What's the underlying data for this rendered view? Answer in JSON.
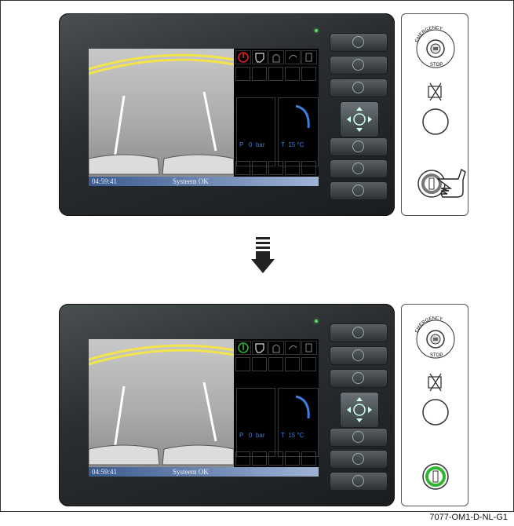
{
  "figure_id": "7077-OM1-D-NL-G1",
  "steps": [
    {
      "time": "04:59:41",
      "status": "Systeem OK",
      "pressure_label": "P",
      "pressure_value": "0",
      "pressure_unit": "bar",
      "temp_label": "T",
      "temp_value": "15",
      "temp_unit": "°C",
      "status_icon_color": "#e02020",
      "key_led_color": "#c8c8c8",
      "emergency_text": "EMERGENCY",
      "stop_text": "STOP"
    },
    {
      "time": "04:59:41",
      "status": "Systeem OK",
      "pressure_label": "P",
      "pressure_value": "0",
      "pressure_unit": "bar",
      "temp_label": "T",
      "temp_value": "15",
      "temp_unit": "°C",
      "status_icon_color": "#2fb52f",
      "key_led_color": "#2fb52f",
      "emergency_text": "EMERGENCY",
      "stop_text": "STOP"
    }
  ],
  "icons": [
    "power-icon",
    "camera-operator-icon",
    "light-alarm-icon",
    "lights-icon",
    "fuel-icon"
  ]
}
